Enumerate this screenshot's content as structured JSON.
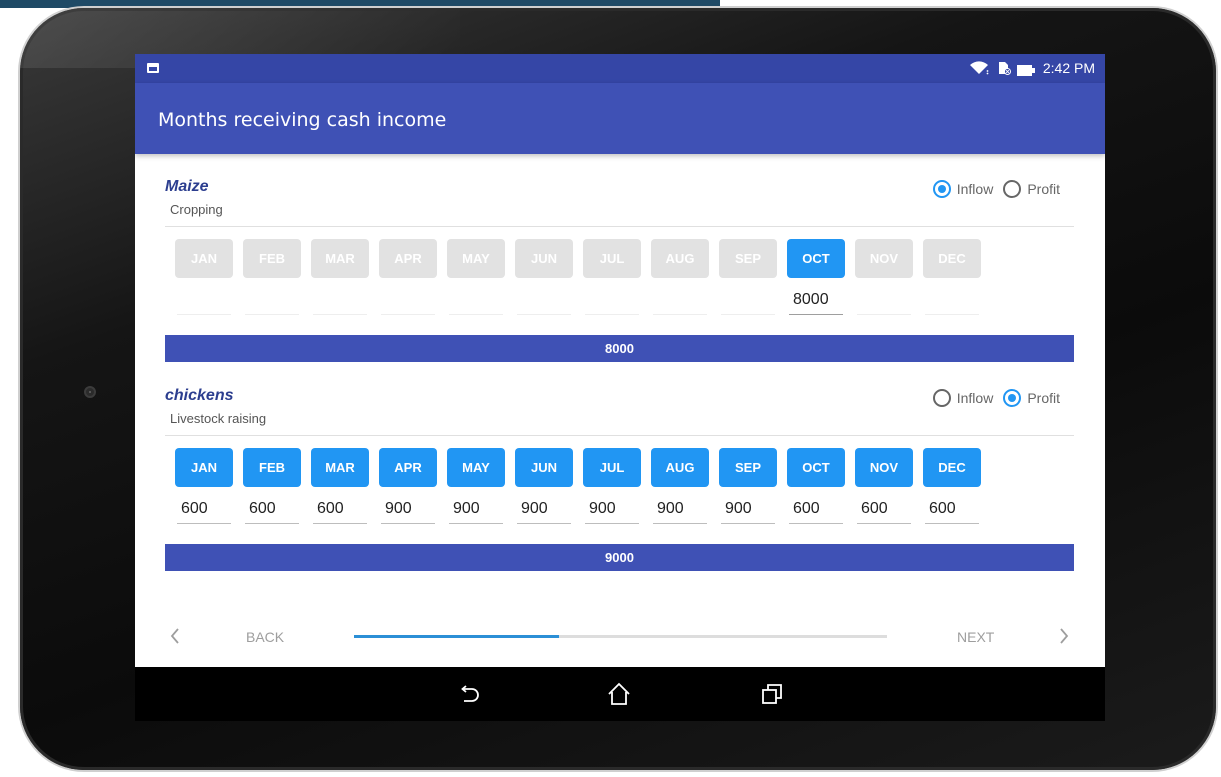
{
  "status_bar": {
    "time": "2:42 PM",
    "icons": [
      "gallery-notification-icon",
      "wifi-icon",
      "sim-icon",
      "battery-icon"
    ]
  },
  "app_bar": {
    "title": "Months receiving cash income"
  },
  "options": {
    "inflow_label": "Inflow",
    "profit_label": "Profit"
  },
  "enterprises": [
    {
      "name": "Maize",
      "category": "Cropping",
      "selected_option": "inflow",
      "months": [
        {
          "label": "JAN",
          "active": false,
          "value": ""
        },
        {
          "label": "FEB",
          "active": false,
          "value": ""
        },
        {
          "label": "MAR",
          "active": false,
          "value": ""
        },
        {
          "label": "APR",
          "active": false,
          "value": ""
        },
        {
          "label": "MAY",
          "active": false,
          "value": ""
        },
        {
          "label": "JUN",
          "active": false,
          "value": ""
        },
        {
          "label": "JUL",
          "active": false,
          "value": ""
        },
        {
          "label": "AUG",
          "active": false,
          "value": ""
        },
        {
          "label": "SEP",
          "active": false,
          "value": ""
        },
        {
          "label": "OCT",
          "active": true,
          "value": "8000"
        },
        {
          "label": "NOV",
          "active": false,
          "value": ""
        },
        {
          "label": "DEC",
          "active": false,
          "value": ""
        }
      ],
      "total": "8000"
    },
    {
      "name": "chickens",
      "category": "Livestock raising",
      "selected_option": "profit",
      "months": [
        {
          "label": "JAN",
          "active": true,
          "value": "600"
        },
        {
          "label": "FEB",
          "active": true,
          "value": "600"
        },
        {
          "label": "MAR",
          "active": true,
          "value": "600"
        },
        {
          "label": "APR",
          "active": true,
          "value": "900"
        },
        {
          "label": "MAY",
          "active": true,
          "value": "900"
        },
        {
          "label": "JUN",
          "active": true,
          "value": "900"
        },
        {
          "label": "JUL",
          "active": true,
          "value": "900"
        },
        {
          "label": "AUG",
          "active": true,
          "value": "900"
        },
        {
          "label": "SEP",
          "active": true,
          "value": "900"
        },
        {
          "label": "OCT",
          "active": true,
          "value": "600"
        },
        {
          "label": "NOV",
          "active": true,
          "value": "600"
        },
        {
          "label": "DEC",
          "active": true,
          "value": "600"
        }
      ],
      "total": "9000"
    }
  ],
  "footer": {
    "back_label": "BACK",
    "next_label": "NEXT",
    "progress": 0.385
  },
  "colors": {
    "primary": "#3f51b5",
    "status_bar": "#3546a6",
    "accent": "#2196f3",
    "inactive_month": "#e0e0e0",
    "progress": "#2b8fd6"
  },
  "nav_bar": {
    "icons": [
      "back-icon",
      "home-icon",
      "recents-icon"
    ]
  }
}
